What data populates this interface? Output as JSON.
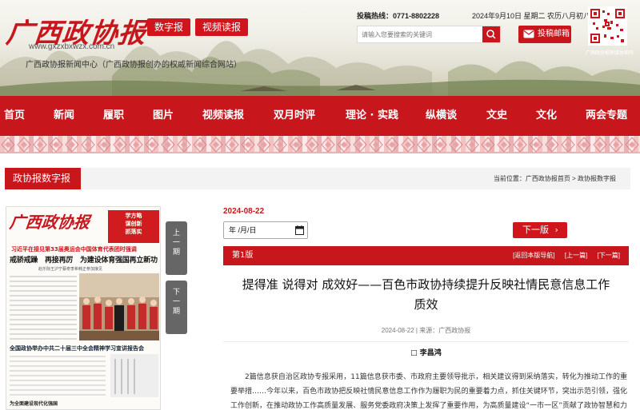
{
  "header": {
    "logo": "广西政协报",
    "site_url": "www.gxzxbxwzx.com.cn",
    "buttons": {
      "digital": "数字报",
      "video": "视频读报"
    },
    "tagline": "广西政协报新闻中心（广西政协报创办的权威新闻综合网站）",
    "hotline": "投稿热线：0771-8802228",
    "date": "2024年9月10日 星期二 农历八月初八",
    "search": {
      "placeholder": "请输入您要搜索的关键词"
    },
    "mail_label": "投稿邮箱",
    "qr_caption": "广西政协报新媒体矩阵"
  },
  "nav": {
    "items": [
      "首页",
      "新闻",
      "履职",
      "图片",
      "视频读报",
      "双月时评",
      "理论 · 实践",
      "纵横谈",
      "文史",
      "文化",
      "两会专题"
    ]
  },
  "section": {
    "title": "政协报数字报",
    "breadcrumb": {
      "prefix": "当前位置：",
      "home": "广西政协报首页",
      "sep": " > ",
      "current": "政协报数字报"
    }
  },
  "newspaper": {
    "logo": "广西政协报",
    "ad_lines": [
      "学方略",
      "谋创新",
      "抓落实"
    ],
    "line1": "习近平在接见第33届奥运会中国体育代表团时强调",
    "headline": "戒骄戒躁　再接再厉　为建设体育强国再立新功",
    "sub": "赵乐际王沪宁蔡奇李希韩正参加接见",
    "headline2": "全国政协举办中共二十届三中全会精神学习宣讲报告会",
    "headline3": "为全面建设现代化强国",
    "prev_label": [
      "上",
      "一",
      "期"
    ],
    "next_label": [
      "下",
      "一",
      "期"
    ]
  },
  "issue": {
    "date": "2024-08-22",
    "date_field": "年 /月/日",
    "next_page": "下一版",
    "edition": "第1版",
    "links": [
      "[返回本版导航]",
      "[上一篇]",
      "[下一篇]"
    ]
  },
  "article": {
    "title_line1": "提得准 说得对 成效好——百色市政协持续提升反映社情民意信息工作",
    "title_line2": "质效",
    "meta": "2024-08-22 | 来源：广西政协报",
    "author": "□ 李昌鸿",
    "body": "2篇信息获自治区政协专报采用，11篇信息获市委、市政府主要领导批示，相关建议得到采纳落实，转化为推动工作的重要举措……今年以来，百色市政协把反映社情民意信息工作作为履职为民的重要着力点，抓住关键环节，突出示范引领，强化工作创新，在推动政协工作高质量发展、服务党委政府决策上发挥了重要作用，为高质量建设“一市一区”贡献了政协智慧和力量。"
  },
  "colors": {
    "brand_red": "#c8161d",
    "nav_red": "#c8161d",
    "page_btn": "#666666"
  }
}
